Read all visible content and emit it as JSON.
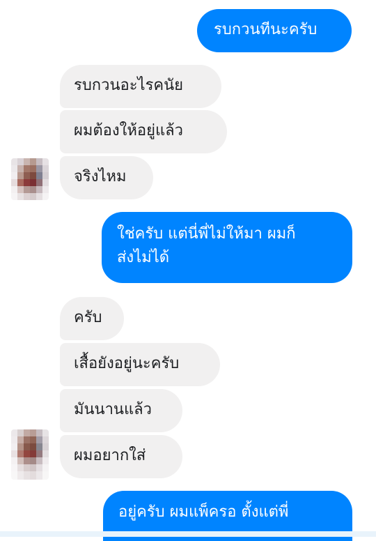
{
  "conversation": {
    "messages": [
      {
        "text": "รบกวนทีนะครับ"
      },
      {
        "text": "รบกวนอะไรคนัย"
      },
      {
        "text": "ผมต้องให้อยู่แล้ว"
      },
      {
        "text": "จริงไหม"
      },
      {
        "line1": "ใช่ครับ แต่นี่พี่ไม่ให้มา ผมก็",
        "line2": "ส่งไม่ได้"
      },
      {
        "text": "ครับ"
      },
      {
        "text": "เสื้อยังอยู่นะครับ"
      },
      {
        "text": "มันนานแล้ว"
      },
      {
        "text": "ผมอยากใส่"
      },
      {
        "line1": "อยู่ครับ ผมแพ็ครอ ตั้งแต่พี่"
      }
    ]
  },
  "colors": {
    "outgoing_bubble": "#0084ff",
    "incoming_bubble": "#f1f0f0",
    "outgoing_text": "#ffffff",
    "incoming_text": "#1c1e21"
  }
}
